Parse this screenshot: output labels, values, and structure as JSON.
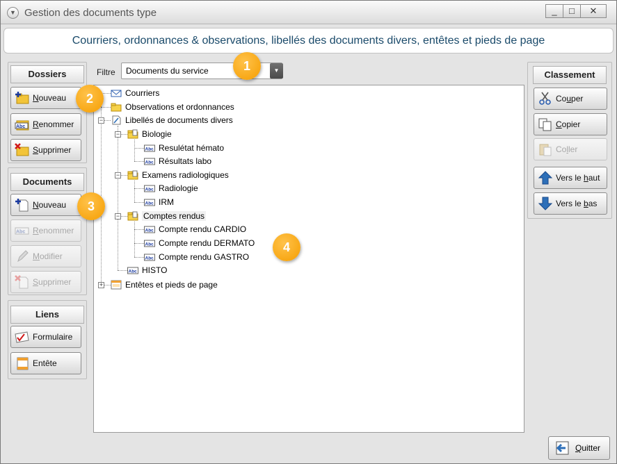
{
  "window": {
    "title": "Gestion des documents type",
    "controls": [
      "_",
      "□",
      "✕"
    ]
  },
  "banner": "Courriers, ordonnances & observations, libellés des documents divers, entêtes et pieds de page",
  "dossiers": {
    "header": "Dossiers",
    "buttons": [
      {
        "pre": "",
        "u": "N",
        "post": "ouveau"
      },
      {
        "pre": "",
        "u": "R",
        "post": "enommer"
      },
      {
        "pre": "",
        "u": "S",
        "post": "upprimer"
      }
    ]
  },
  "documents": {
    "header": "Documents",
    "buttons": [
      {
        "pre": "",
        "u": "N",
        "post": "ouveau"
      },
      {
        "pre": "",
        "u": "R",
        "post": "enommer"
      },
      {
        "pre": "",
        "u": "M",
        "post": "odifier"
      },
      {
        "pre": "",
        "u": "S",
        "post": "upprimer"
      }
    ]
  },
  "liens": {
    "header": "Liens",
    "buttons": [
      "Formulaire",
      "Entête"
    ]
  },
  "filter": {
    "label": "Filtre",
    "value": "Documents du service"
  },
  "tree": [
    {
      "label": "Courriers",
      "icon": "envelope-icon"
    },
    {
      "label": "Observations et ordonnances",
      "icon": "folder-icon"
    },
    {
      "label": "Libellés de documents divers",
      "icon": "document-icon"
    },
    {
      "label": "Biologie",
      "icon": "folder-icon"
    },
    {
      "label": "Resulétat hémato",
      "icon": "abc-icon"
    },
    {
      "label": "Résultats labo",
      "icon": "abc-icon"
    },
    {
      "label": "Examens radiologiques",
      "icon": "folder-icon"
    },
    {
      "label": "Radiologie",
      "icon": "abc-icon"
    },
    {
      "label": "IRM",
      "icon": "abc-icon"
    },
    {
      "label": "Comptes rendus",
      "icon": "folder-icon"
    },
    {
      "label": "Compte rendu CARDIO",
      "icon": "abc-icon"
    },
    {
      "label": "Compte rendu DERMATO",
      "icon": "abc-icon"
    },
    {
      "label": "Compte rendu GASTRO",
      "icon": "abc-icon"
    },
    {
      "label": "HISTO",
      "icon": "abc-icon"
    },
    {
      "label": "Entêtes et pieds de page",
      "icon": "header-footer-icon"
    }
  ],
  "classement": {
    "header": "Classement",
    "buttons": [
      {
        "pre": "Co",
        "u": "u",
        "post": "per"
      },
      {
        "pre": "",
        "u": "C",
        "post": "opier"
      },
      {
        "pre": "Co",
        "u": "l",
        "post": "ler"
      },
      {
        "pre": "Vers le ",
        "u": "h",
        "post": "aut"
      },
      {
        "pre": "Vers le ",
        "u": "b",
        "post": "as"
      }
    ]
  },
  "quit": {
    "pre": "",
    "u": "Q",
    "post": "uitter"
  },
  "callouts": [
    "1",
    "2",
    "3",
    "4"
  ],
  "colors": {
    "banner_text": "#1a4a6a",
    "callout": "#f5a000",
    "arrow_blue": "#2d6fb8"
  }
}
